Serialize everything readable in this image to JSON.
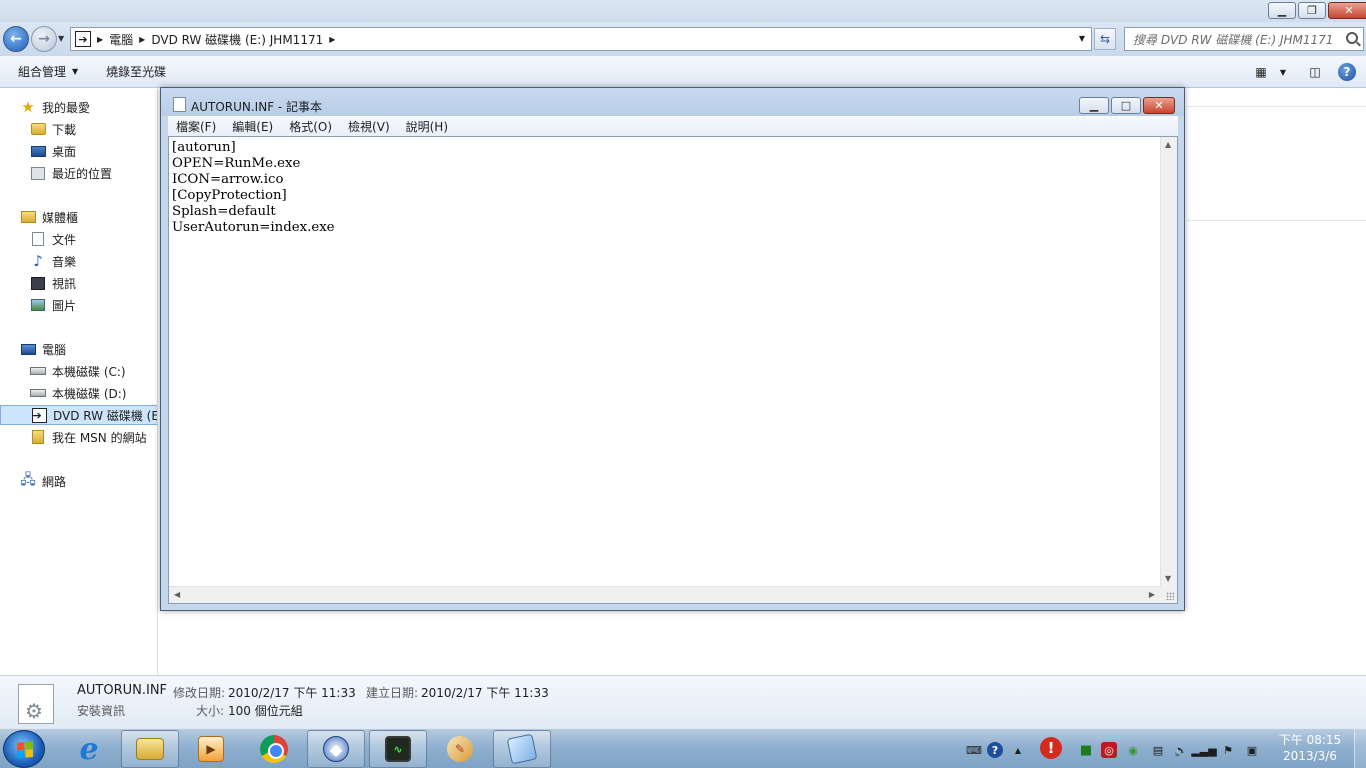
{
  "explorer": {
    "breadcrumb": [
      "電腦",
      "DVD RW 磁碟機 (E:) JHM1171"
    ],
    "search_placeholder": "搜尋 DVD RW 磁碟機 (E:) JHM1171",
    "commands": {
      "organize": "組合管理",
      "burn": "燒錄至光碟"
    },
    "nav": {
      "favorites": "我的最愛",
      "downloads": "下載",
      "desktop": "桌面",
      "recent": "最近的位置",
      "libraries": "媒體櫃",
      "documents": "文件",
      "music": "音樂",
      "videos": "視訊",
      "pictures": "圖片",
      "computer": "電腦",
      "drive_c": "本機磁碟 (C:)",
      "drive_d": "本機磁碟 (D:)",
      "drive_e": "DVD RW 磁碟機 (E:)",
      "msn": "我在 MSN 的網站",
      "network": "網路"
    },
    "details": {
      "file_name": "AUTORUN.INF",
      "file_type": "安裝資訊",
      "modified_label": "修改日期:",
      "modified_value": "2010/2/17 下午 11:33",
      "created_label": "建立日期:",
      "created_value": "2010/2/17 下午 11:33",
      "size_label": "大小:",
      "size_value": "100 個位元組"
    }
  },
  "notepad": {
    "title": "AUTORUN.INF - 記事本",
    "menu": [
      "檔案(F)",
      "編輯(E)",
      "格式(O)",
      "檢視(V)",
      "說明(H)"
    ],
    "content": "[autorun]\nOPEN=RunMe.exe\nICON=arrow.ico\n[CopyProtection]\nSplash=default\nUserAutorun=index.exe"
  },
  "taskbar": {
    "clock_time": "下午 08:15",
    "clock_date": "2013/3/6",
    "pinned": [
      "internet-explorer",
      "windows-explorer",
      "media-player",
      "chrome",
      "setup",
      "system-monitor",
      "paint",
      "notepad"
    ]
  },
  "icons": {
    "back": "back-arrow-icon",
    "forward": "forward-arrow-icon",
    "refresh": "refresh-icon",
    "search": "search-icon",
    "help": "help-icon"
  },
  "colors": {
    "selection": "#cde5fb",
    "titlebar": "#c9daf0",
    "close_button": "#c74531",
    "taskbar": "#8fb0cf"
  }
}
